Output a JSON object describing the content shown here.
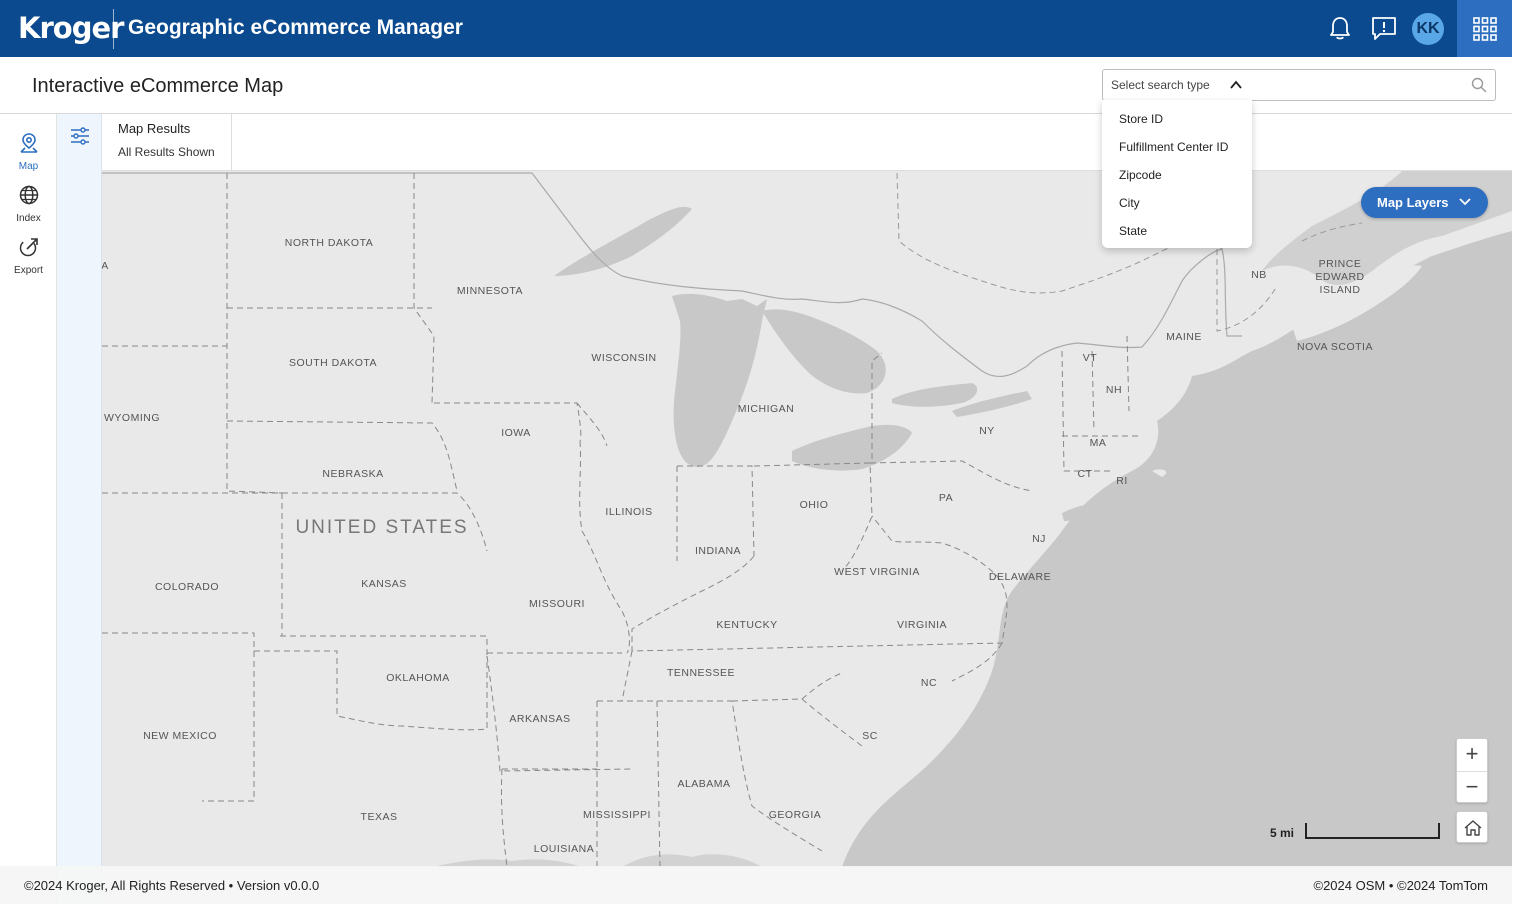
{
  "header": {
    "logo_text": "Kroger",
    "app_title": "Geographic eCommerce Manager",
    "avatar_initials": "KK"
  },
  "subheader": {
    "page_title": "Interactive eCommerce Map",
    "search_type_placeholder": "Select search type",
    "search_placeholder": ""
  },
  "search_type_options": [
    "Store ID",
    "Fulfillment Center ID",
    "Zipcode",
    "City",
    "State"
  ],
  "rail": {
    "items": [
      {
        "label": "Map",
        "icon": "map-pin-icon"
      },
      {
        "label": "Index",
        "icon": "globe-icon"
      },
      {
        "label": "Export",
        "icon": "export-icon"
      }
    ]
  },
  "results": {
    "title": "Map Results",
    "subtitle": "All Results Shown"
  },
  "map": {
    "layers_button": "Map Layers",
    "country_label": "UNITED STATES",
    "state_labels": [
      "NORTH DAKOTA",
      "MINNESOTA",
      "SOUTH DAKOTA",
      "WISCONSIN",
      "WYOMING",
      "MICHIGAN",
      "IOWA",
      "NEBRASKA",
      "ILLINOIS",
      "OHIO",
      "INDIANA",
      "PA",
      "NY",
      "COLORADO",
      "KANSAS",
      "MISSOURI",
      "WEST VIRGINIA",
      "KENTUCKY",
      "VIRGINIA",
      "OKLAHOMA",
      "TENNESSEE",
      "ARKANSAS",
      "NEW MEXICO",
      "NC",
      "SC",
      "ALABAMA",
      "MISSISSIPPI",
      "GEORGIA",
      "TEXAS",
      "LOUISIANA",
      "VT",
      "NH",
      "MA",
      "CT",
      "RI",
      "NJ",
      "DELAWARE",
      "MAINE",
      "NB",
      "PRINCE",
      "EDWARD",
      "ISLAND",
      "NOVA SCOTIA",
      "A"
    ],
    "zoom_in": "+",
    "zoom_out": "−",
    "scale_label": "5 mi"
  },
  "footer": {
    "copyright": "©2024 Kroger, All Rights Reserved • Version v0.0.0",
    "attribution": "©2024 OSM • ©2024 TomTom"
  },
  "colors": {
    "header_bg": "#0b4a8f",
    "accent": "#2d6ec0",
    "map_land": "#e9e9e9",
    "map_water": "#c8c8c8"
  }
}
